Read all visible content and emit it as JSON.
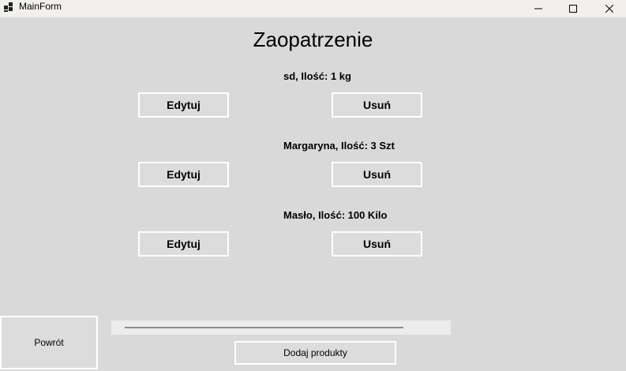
{
  "window": {
    "title": "MainForm",
    "icons": {
      "app": "app-icon",
      "minimize": "minimize-icon",
      "maximize": "maximize-icon",
      "close": "close-icon"
    }
  },
  "main": {
    "title": "Zaopatrzenie",
    "items": [
      {
        "label": "sd, Ilość: 1 kg",
        "edit_label": "Edytuj",
        "delete_label": "Usuń"
      },
      {
        "label": "Margaryna, Ilość: 3 Szt",
        "edit_label": "Edytuj",
        "delete_label": "Usuń"
      },
      {
        "label": "Masło, Ilość: 100 Kilo",
        "edit_label": "Edytuj",
        "delete_label": "Usuń"
      }
    ]
  },
  "footer": {
    "back_label": "Powrót",
    "add_label": "Dodaj produkty"
  },
  "colors": {
    "background": "#d9d9d9",
    "titlebar": "#f2f0ee",
    "button_border": "#ffffff"
  }
}
